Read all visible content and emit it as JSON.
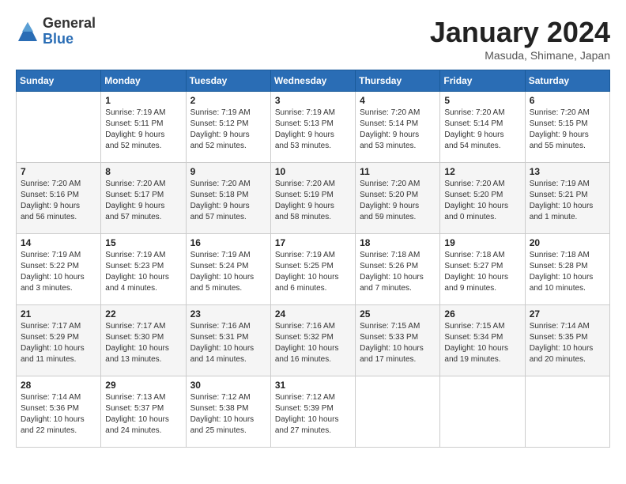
{
  "header": {
    "logo_general": "General",
    "logo_blue": "Blue",
    "month_title": "January 2024",
    "location": "Masuda, Shimane, Japan"
  },
  "days_of_week": [
    "Sunday",
    "Monday",
    "Tuesday",
    "Wednesday",
    "Thursday",
    "Friday",
    "Saturday"
  ],
  "weeks": [
    [
      {
        "day": "",
        "info": ""
      },
      {
        "day": "1",
        "info": "Sunrise: 7:19 AM\nSunset: 5:11 PM\nDaylight: 9 hours\nand 52 minutes."
      },
      {
        "day": "2",
        "info": "Sunrise: 7:19 AM\nSunset: 5:12 PM\nDaylight: 9 hours\nand 52 minutes."
      },
      {
        "day": "3",
        "info": "Sunrise: 7:19 AM\nSunset: 5:13 PM\nDaylight: 9 hours\nand 53 minutes."
      },
      {
        "day": "4",
        "info": "Sunrise: 7:20 AM\nSunset: 5:14 PM\nDaylight: 9 hours\nand 53 minutes."
      },
      {
        "day": "5",
        "info": "Sunrise: 7:20 AM\nSunset: 5:14 PM\nDaylight: 9 hours\nand 54 minutes."
      },
      {
        "day": "6",
        "info": "Sunrise: 7:20 AM\nSunset: 5:15 PM\nDaylight: 9 hours\nand 55 minutes."
      }
    ],
    [
      {
        "day": "7",
        "info": "Sunrise: 7:20 AM\nSunset: 5:16 PM\nDaylight: 9 hours\nand 56 minutes."
      },
      {
        "day": "8",
        "info": "Sunrise: 7:20 AM\nSunset: 5:17 PM\nDaylight: 9 hours\nand 57 minutes."
      },
      {
        "day": "9",
        "info": "Sunrise: 7:20 AM\nSunset: 5:18 PM\nDaylight: 9 hours\nand 57 minutes."
      },
      {
        "day": "10",
        "info": "Sunrise: 7:20 AM\nSunset: 5:19 PM\nDaylight: 9 hours\nand 58 minutes."
      },
      {
        "day": "11",
        "info": "Sunrise: 7:20 AM\nSunset: 5:20 PM\nDaylight: 9 hours\nand 59 minutes."
      },
      {
        "day": "12",
        "info": "Sunrise: 7:20 AM\nSunset: 5:20 PM\nDaylight: 10 hours\nand 0 minutes."
      },
      {
        "day": "13",
        "info": "Sunrise: 7:19 AM\nSunset: 5:21 PM\nDaylight: 10 hours\nand 1 minute."
      }
    ],
    [
      {
        "day": "14",
        "info": "Sunrise: 7:19 AM\nSunset: 5:22 PM\nDaylight: 10 hours\nand 3 minutes."
      },
      {
        "day": "15",
        "info": "Sunrise: 7:19 AM\nSunset: 5:23 PM\nDaylight: 10 hours\nand 4 minutes."
      },
      {
        "day": "16",
        "info": "Sunrise: 7:19 AM\nSunset: 5:24 PM\nDaylight: 10 hours\nand 5 minutes."
      },
      {
        "day": "17",
        "info": "Sunrise: 7:19 AM\nSunset: 5:25 PM\nDaylight: 10 hours\nand 6 minutes."
      },
      {
        "day": "18",
        "info": "Sunrise: 7:18 AM\nSunset: 5:26 PM\nDaylight: 10 hours\nand 7 minutes."
      },
      {
        "day": "19",
        "info": "Sunrise: 7:18 AM\nSunset: 5:27 PM\nDaylight: 10 hours\nand 9 minutes."
      },
      {
        "day": "20",
        "info": "Sunrise: 7:18 AM\nSunset: 5:28 PM\nDaylight: 10 hours\nand 10 minutes."
      }
    ],
    [
      {
        "day": "21",
        "info": "Sunrise: 7:17 AM\nSunset: 5:29 PM\nDaylight: 10 hours\nand 11 minutes."
      },
      {
        "day": "22",
        "info": "Sunrise: 7:17 AM\nSunset: 5:30 PM\nDaylight: 10 hours\nand 13 minutes."
      },
      {
        "day": "23",
        "info": "Sunrise: 7:16 AM\nSunset: 5:31 PM\nDaylight: 10 hours\nand 14 minutes."
      },
      {
        "day": "24",
        "info": "Sunrise: 7:16 AM\nSunset: 5:32 PM\nDaylight: 10 hours\nand 16 minutes."
      },
      {
        "day": "25",
        "info": "Sunrise: 7:15 AM\nSunset: 5:33 PM\nDaylight: 10 hours\nand 17 minutes."
      },
      {
        "day": "26",
        "info": "Sunrise: 7:15 AM\nSunset: 5:34 PM\nDaylight: 10 hours\nand 19 minutes."
      },
      {
        "day": "27",
        "info": "Sunrise: 7:14 AM\nSunset: 5:35 PM\nDaylight: 10 hours\nand 20 minutes."
      }
    ],
    [
      {
        "day": "28",
        "info": "Sunrise: 7:14 AM\nSunset: 5:36 PM\nDaylight: 10 hours\nand 22 minutes."
      },
      {
        "day": "29",
        "info": "Sunrise: 7:13 AM\nSunset: 5:37 PM\nDaylight: 10 hours\nand 24 minutes."
      },
      {
        "day": "30",
        "info": "Sunrise: 7:12 AM\nSunset: 5:38 PM\nDaylight: 10 hours\nand 25 minutes."
      },
      {
        "day": "31",
        "info": "Sunrise: 7:12 AM\nSunset: 5:39 PM\nDaylight: 10 hours\nand 27 minutes."
      },
      {
        "day": "",
        "info": ""
      },
      {
        "day": "",
        "info": ""
      },
      {
        "day": "",
        "info": ""
      }
    ]
  ]
}
